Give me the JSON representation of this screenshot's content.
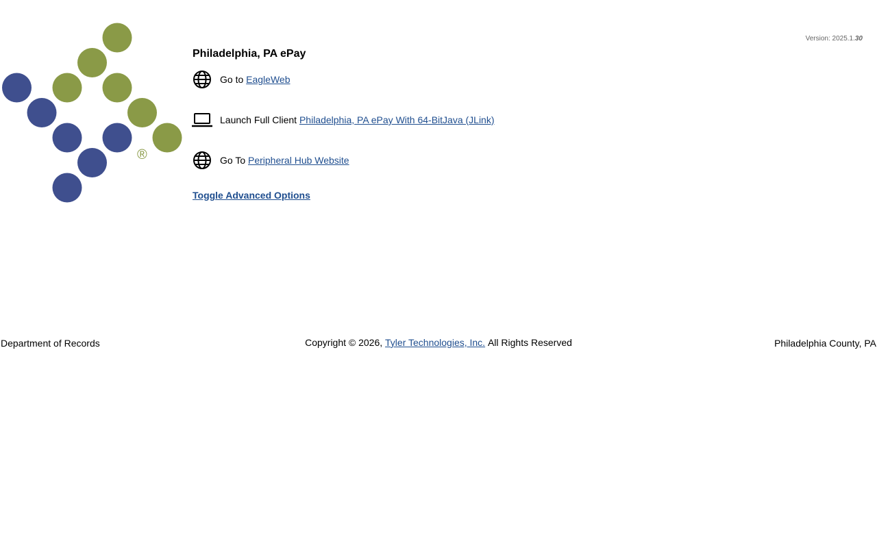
{
  "app": {
    "title": "Philadelphia, PA ePay",
    "version_label": "Version: 2025.1.",
    "version_build": "30",
    "logo_name": "tyler-dots-logo",
    "logo_registered_mark": "®",
    "colors": {
      "logo_blue": "#3f4f8e",
      "logo_green": "#8a9a47",
      "link": "#1f4e8f"
    }
  },
  "links": [
    {
      "icon": "globe-icon",
      "prefix": "Go to",
      "label": "EagleWeb"
    },
    {
      "icon": "laptop-icon",
      "prefix": "Launch Full Client",
      "label": "Philadelphia, PA ePay With 64-BitJava (JLink)"
    },
    {
      "icon": "globe-icon",
      "prefix": "Go To",
      "label": "Peripheral Hub Website"
    }
  ],
  "advanced": {
    "toggle_label": "Toggle Advanced Options"
  },
  "footer": {
    "left": "Department of Records",
    "copyright_prefix": "Copyright © 2026,",
    "company_link": "Tyler Technologies, Inc.",
    "copyright_suffix": "All Rights Reserved",
    "right": "Philadelphia County, PA"
  }
}
